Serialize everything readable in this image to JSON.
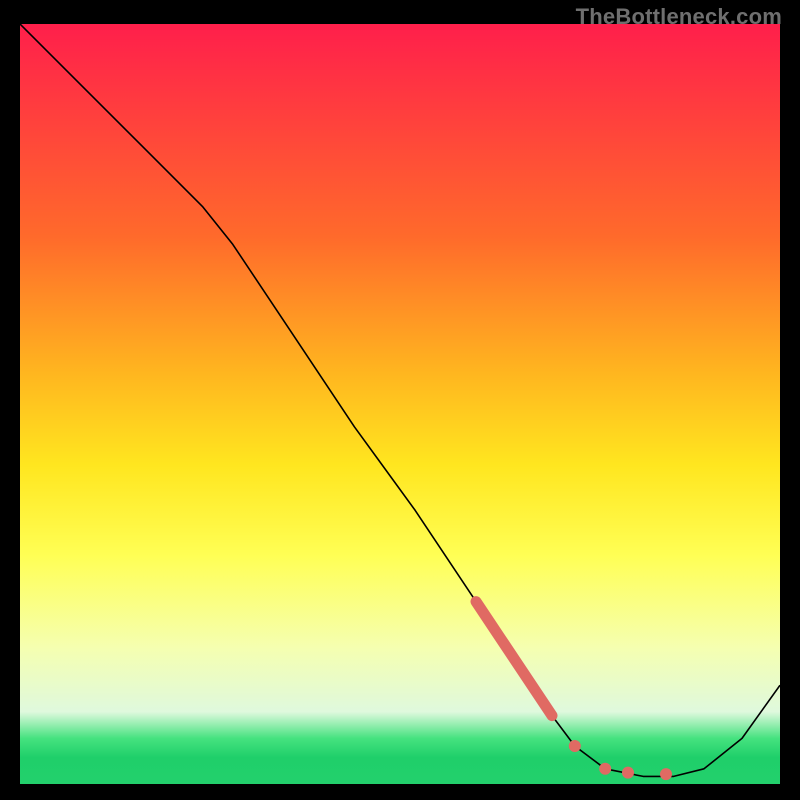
{
  "watermark": "TheBottleneck.com",
  "chart_data": {
    "type": "line",
    "title": "",
    "xlabel": "",
    "ylabel": "",
    "xlim": [
      0,
      100
    ],
    "ylim": [
      0,
      100
    ],
    "grid": false,
    "gradient_stops": [
      {
        "offset": 0.0,
        "color": "#ff1f4b"
      },
      {
        "offset": 0.28,
        "color": "#ff6a2b"
      },
      {
        "offset": 0.46,
        "color": "#ffb61f"
      },
      {
        "offset": 0.58,
        "color": "#ffe61f"
      },
      {
        "offset": 0.7,
        "color": "#ffff55"
      },
      {
        "offset": 0.82,
        "color": "#f5ffb0"
      },
      {
        "offset": 0.905,
        "color": "#dff9dd"
      },
      {
        "offset": 0.94,
        "color": "#45e27f"
      },
      {
        "offset": 0.965,
        "color": "#1fcf6a"
      },
      {
        "offset": 1.0,
        "color": "#23d06c"
      }
    ],
    "series": [
      {
        "name": "curve",
        "kind": "line",
        "stroke": "#000000",
        "stroke_width": 1.6,
        "x": [
          0,
          8,
          16,
          24,
          28,
          36,
          44,
          52,
          60,
          66,
          70,
          73,
          77,
          82,
          86,
          90,
          95,
          100
        ],
        "y": [
          100,
          92,
          84,
          76,
          71,
          59,
          47,
          36,
          24,
          15,
          9,
          5,
          2,
          1,
          1,
          2,
          6,
          13
        ]
      },
      {
        "name": "thick-segment",
        "kind": "line",
        "stroke": "#e06a63",
        "stroke_width": 11,
        "stroke_linecap": "round",
        "x": [
          60,
          70
        ],
        "y": [
          24,
          9
        ]
      },
      {
        "name": "dots",
        "kind": "scatter",
        "color": "#e06a63",
        "radius": 6,
        "x": [
          73,
          77,
          80,
          85
        ],
        "y": [
          5,
          2,
          1.5,
          1.3
        ]
      }
    ]
  }
}
